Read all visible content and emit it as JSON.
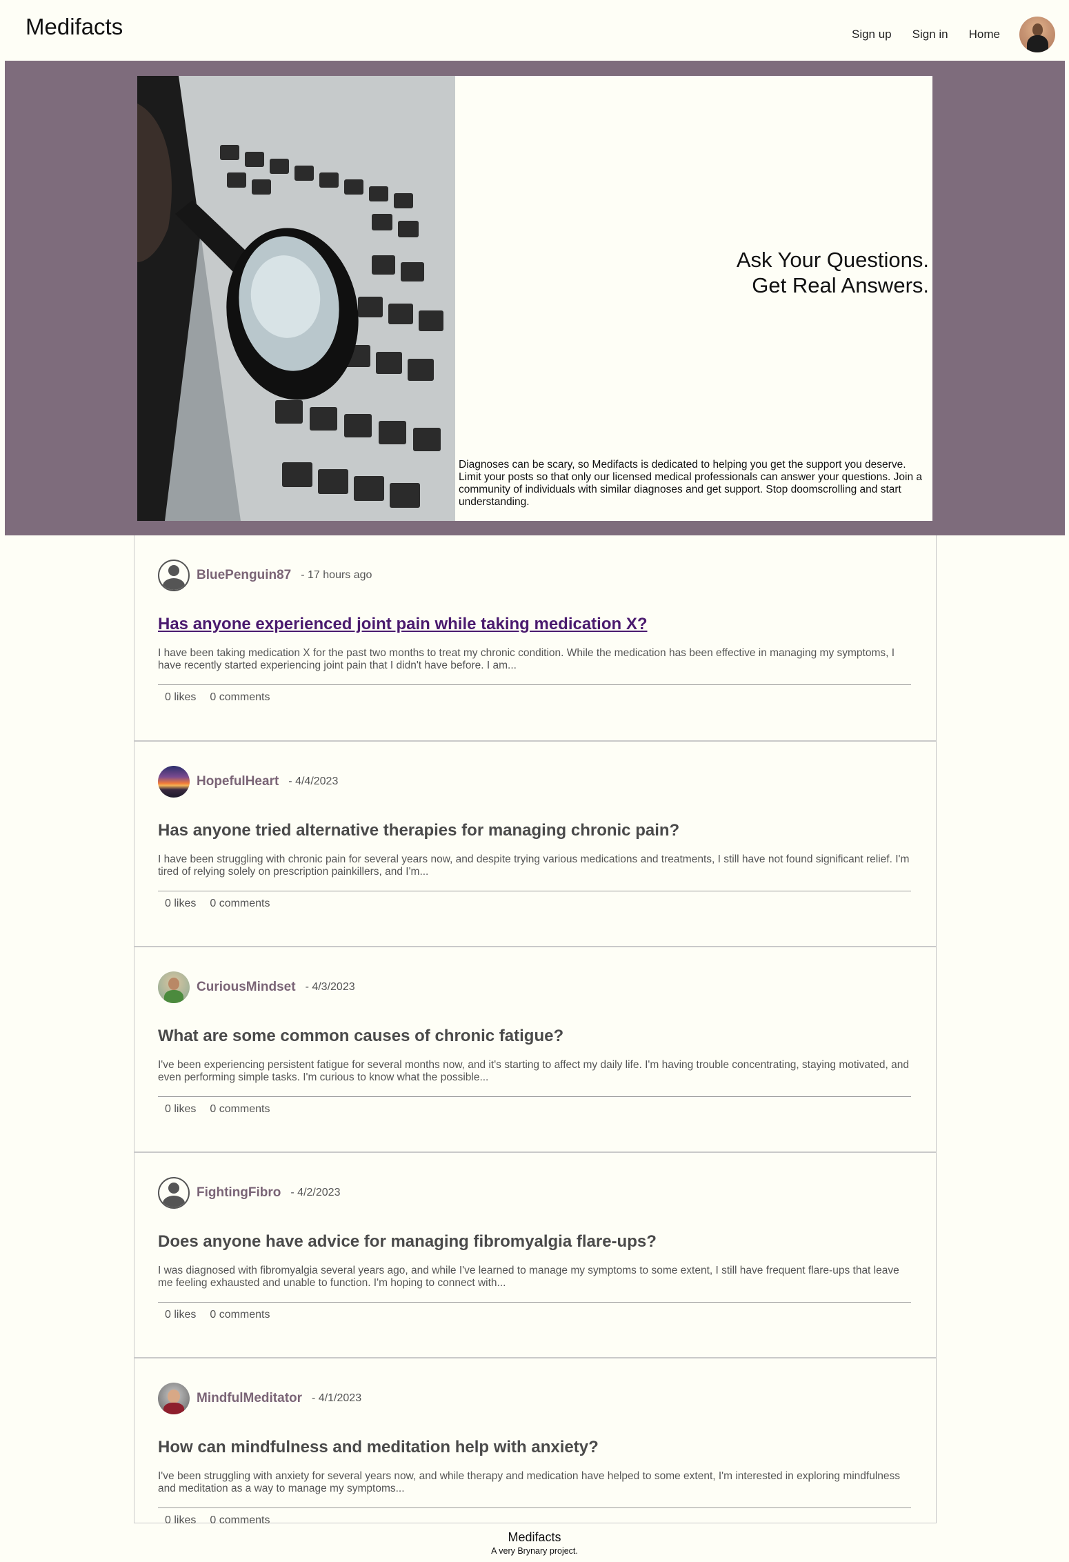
{
  "header": {
    "brand": "Medifacts",
    "nav": [
      {
        "label": "Sign up"
      },
      {
        "label": "Sign in"
      },
      {
        "label": "Home"
      }
    ],
    "avatar_icon": "user-avatar-icon"
  },
  "hero": {
    "headline_line1": "Ask Your Questions.",
    "headline_line2": "Get Real Answers.",
    "description": "Diagnoses can be scary, so Medifacts is dedicated to helping you get the support you deserve. Limit your posts so that only our licensed medical professionals can answer your questions. Join a community of individuals with similar diagnoses and get support. Stop doomscrolling and start understanding.",
    "colors": {
      "band": "#7e6c7c",
      "panel": "#fefef6"
    }
  },
  "posts": [
    {
      "author": "BluePenguin87",
      "time": "- 17 hours ago",
      "title": "Has anyone experienced joint pain while taking medication X?",
      "body": "I have been taking medication X for the past two months to treat my chronic condition. While the medication has been effective in managing my symptoms, I have recently started experiencing joint pain that I didn't have before. I am...",
      "likes": "0 likes",
      "comments": "0 comments"
    },
    {
      "author": "HopefulHeart",
      "time": "- 4/4/2023",
      "title": "Has anyone tried alternative therapies for managing chronic pain?",
      "body": "I have been struggling with chronic pain for several years now, and despite trying various medications and treatments, I still have not found significant relief. I'm tired of relying solely on prescription painkillers, and I'm...",
      "likes": "0 likes",
      "comments": "0 comments"
    },
    {
      "author": "CuriousMindset",
      "time": "- 4/3/2023",
      "title": "What are some common causes of chronic fatigue?",
      "body": "I've been experiencing persistent fatigue for several months now, and it's starting to affect my daily life. I'm having trouble concentrating, staying motivated, and even performing simple tasks. I'm curious to know what the possible...",
      "likes": "0 likes",
      "comments": "0 comments"
    },
    {
      "author": "FightingFibro",
      "time": "- 4/2/2023",
      "title": "Does anyone have advice for managing fibromyalgia flare-ups?",
      "body": "I was diagnosed with fibromyalgia several years ago, and while I've learned to manage my symptoms to some extent, I still have frequent flare-ups that leave me feeling exhausted and unable to function. I'm hoping to connect with...",
      "likes": "0 likes",
      "comments": "0 comments"
    },
    {
      "author": "MindfulMeditator",
      "time": "- 4/1/2023",
      "title": "How can mindfulness and meditation help with anxiety?",
      "body": "I've been struggling with anxiety for several years now, and while therapy and medication have helped to some extent, I'm interested in exploring mindfulness and meditation as a way to manage my symptoms...",
      "likes": "0 likes",
      "comments": "0 comments"
    }
  ],
  "footer": {
    "title": "Medifacts",
    "tagline": "A very Brynary project."
  },
  "colors": {
    "background": "#fefef6",
    "author": "#7a6476",
    "visited_link": "#4a1a6e"
  }
}
